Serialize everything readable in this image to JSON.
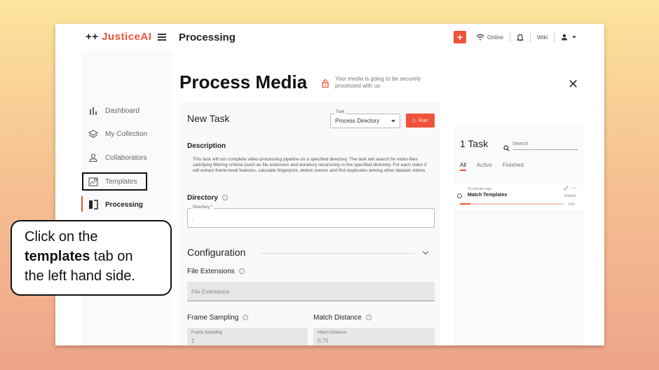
{
  "topbar": {
    "logo_prefix": "++",
    "logo_brand": "JusticeAI",
    "title": "Processing",
    "plus_label": "+",
    "online_label": "Online",
    "wiki_label": "Wiki"
  },
  "sidebar": {
    "items": [
      {
        "label": "Dashboard",
        "icon": "bar-chart-icon"
      },
      {
        "label": "My Collection",
        "icon": "layers-icon"
      },
      {
        "label": "Collaborators",
        "icon": "person-icon"
      },
      {
        "label": "Templates",
        "icon": "image-search-icon"
      },
      {
        "label": "Processing",
        "icon": "compare-icon"
      }
    ],
    "active": "Processing"
  },
  "main": {
    "title": "Process Media",
    "secure_text": "Your media is going to be securely processed with us",
    "card": {
      "title": "New Task",
      "task_label": "Task",
      "task_value": "Process Directory",
      "run_label": "Run",
      "description_title": "Description",
      "description": "This task will run complete video-processing pipeline on a specified directory. The task will search for video-files satisfying filtering criteria (such as file extension and duration) recursively in the specified directory. For each video it will extract frame-level features, calculate fingerprint, detect scenes and find duplicates among other dataset videos",
      "directory_title": "Directory",
      "directory_label": "Directory *",
      "directory_value": ".",
      "config_title": "Configuration",
      "file_ext_title": "File Extensions",
      "file_ext_placeholder": "File Extensions",
      "frame_sampling_title": "Frame Sampling",
      "frame_sampling_label": "Frame Sampling",
      "frame_sampling_value": "1",
      "match_distance_title": "Match Distance",
      "match_distance_label": "Match Distance",
      "match_distance_value": "0.75"
    }
  },
  "tasks_panel": {
    "count_label": "1 Task",
    "search_placeholder": "Search",
    "tabs": [
      "All",
      "Active",
      "Finished"
    ],
    "active_tab": "All",
    "tasks": [
      {
        "time": "20 minutes ago",
        "name": "Match Templates",
        "status": "Started",
        "progress_label": "10%",
        "progress": 0.1
      }
    ]
  },
  "callout": {
    "line1": "Click on the",
    "bold": "templates",
    "line2": " tab on",
    "line3": "the left hand side."
  },
  "colors": {
    "accent": "#f0523a"
  }
}
